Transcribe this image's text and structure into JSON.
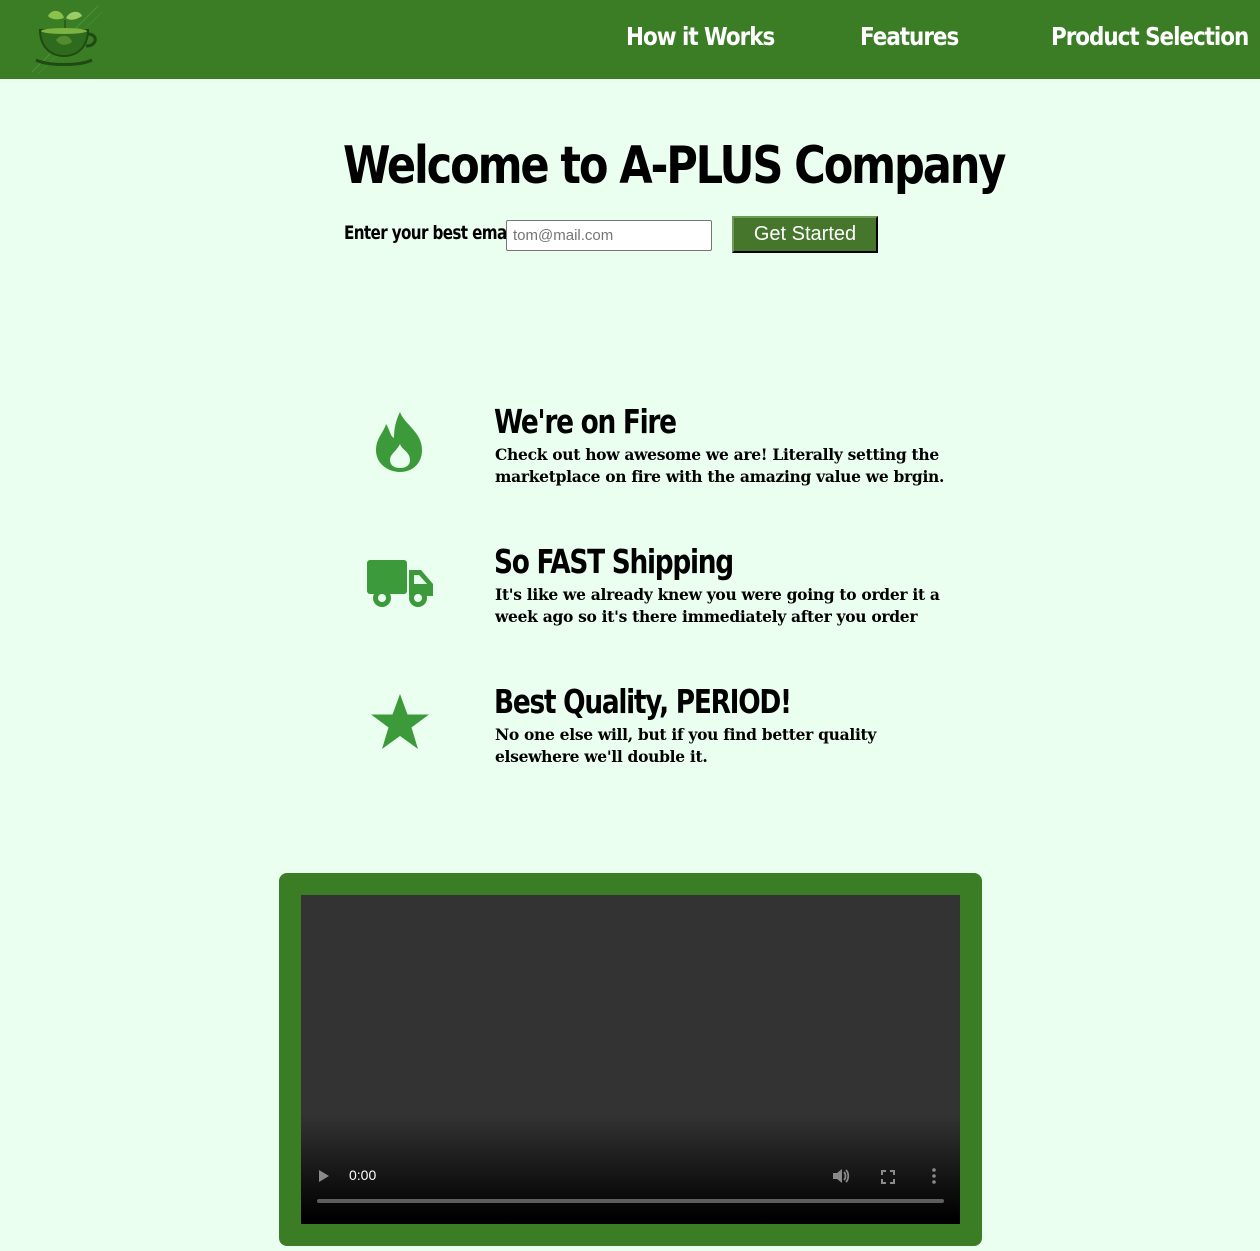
{
  "header": {
    "logo_icon": "tea-cup-leaf-icon",
    "nav": [
      {
        "label": "How it Works"
      },
      {
        "label": "Features"
      },
      {
        "label": "Product Selection"
      }
    ]
  },
  "hero": {
    "title": "Welcome to A-PLUS Company",
    "email_label": "Enter your best email:",
    "email_placeholder": "tom@mail.com",
    "email_value": "",
    "button_label": "Get Started"
  },
  "features": [
    {
      "icon": "fire-icon",
      "title": "We're on Fire",
      "description": "Check out how awesome we are! Literally setting the marketplace on fire with the amazing value we brgin."
    },
    {
      "icon": "truck-icon",
      "title": "So FAST Shipping",
      "description": "It's like we already knew you were going to order it a week ago so it's there immediately after you order"
    },
    {
      "icon": "star-icon",
      "title": "Best Quality, PERIOD!",
      "description": "No one else will, but if you find better quality elsewhere we'll double it."
    }
  ],
  "video": {
    "time": "0:00",
    "progress": 0
  },
  "colors": {
    "header_bg": "#3a7d25",
    "page_bg": "#ebfff1",
    "accent": "#3d9a3a",
    "button_bg": "#46762c"
  }
}
